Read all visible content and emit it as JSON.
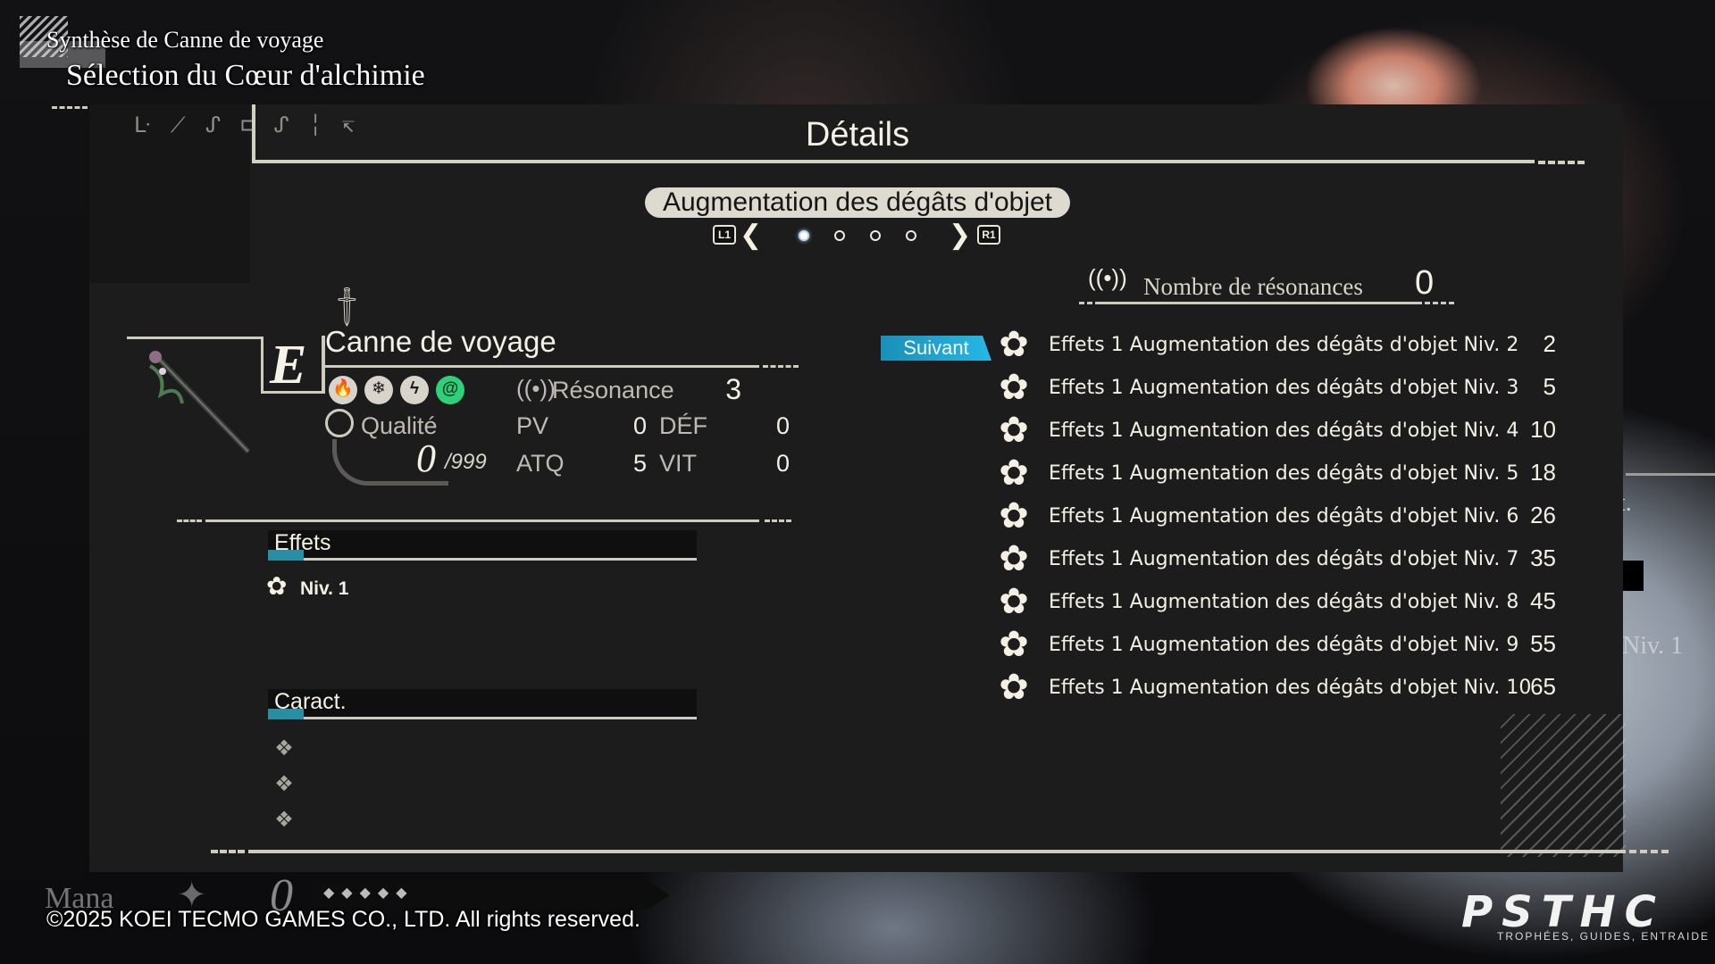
{
  "header": {
    "subtitle": "Synthèse de Canne de voyage",
    "title": "Sélection du Cœur d'alchimie"
  },
  "panel": {
    "symbol_text": "ᒷ ⟋ ᔑ ⊏ ᔑ ╎ ↸",
    "title": "Détails"
  },
  "pager": {
    "current_label": "Augmentation des dégâts d'objet",
    "left_button": "L1",
    "right_button": "R1",
    "pages": 4,
    "active_page": 1
  },
  "resonance_count": {
    "label": "Nombre de résonances",
    "value": "0"
  },
  "item": {
    "grade": "E",
    "name": "Canne de voyage",
    "elements": [
      "fire-icon",
      "ice-icon",
      "lightning-icon",
      "wind-icon"
    ],
    "resonance_label": "Résonance",
    "resonance_value": "3",
    "quality_label": "Qualité",
    "quality_value": "0",
    "quality_max": "/999",
    "stats": {
      "pv_label": "PV",
      "pv_value": "0",
      "def_label": "DÉF",
      "def_value": "0",
      "atq_label": "ATQ",
      "atq_value": "5",
      "vit_label": "VIT",
      "vit_value": "0"
    }
  },
  "effects_section": {
    "title": "Effets",
    "level": "Niv. 1"
  },
  "traits_section": {
    "title": "Caract.",
    "slots": 3
  },
  "effects_list": {
    "next_label": "Suivant",
    "rows": [
      {
        "text": "Effets 1 Augmentation des dégâts d'objet Niv. 2",
        "value": "2"
      },
      {
        "text": "Effets 1 Augmentation des dégâts d'objet Niv. 3",
        "value": "5"
      },
      {
        "text": "Effets 1 Augmentation des dégâts d'objet Niv. 4",
        "value": "10"
      },
      {
        "text": "Effets 1 Augmentation des dégâts d'objet Niv. 5",
        "value": "18"
      },
      {
        "text": "Effets 1 Augmentation des dégâts d'objet Niv. 6",
        "value": "26"
      },
      {
        "text": "Effets 1 Augmentation des dégâts d'objet Niv. 7",
        "value": "35"
      },
      {
        "text": "Effets 1 Augmentation des dégâts d'objet Niv. 8",
        "value": "45"
      },
      {
        "text": "Effets 1 Augmentation des dégâts d'objet Niv. 9",
        "value": "55"
      },
      {
        "text": "Effets 1 Augmentation des dégâts d'objet Niv. 10",
        "value": "65"
      }
    ]
  },
  "background_text": {
    "right_t": "t.",
    "right_niv": "Niv. 1"
  },
  "hud": {
    "mana_label": "Mana",
    "mana_value": "0"
  },
  "copyright": "©2025 KOEI TECMO GAMES CO., LTD. All rights reserved.",
  "watermark": {
    "logo": "PSTHC",
    "tagline": "TROPHÉES, GUIDES, ENTRAIDE"
  },
  "colors": {
    "accent_blue": "#27b7e6",
    "section_accent": "#2a8ea3",
    "line": "#cfcbbf",
    "panel_bg": "#1c1c1d"
  }
}
